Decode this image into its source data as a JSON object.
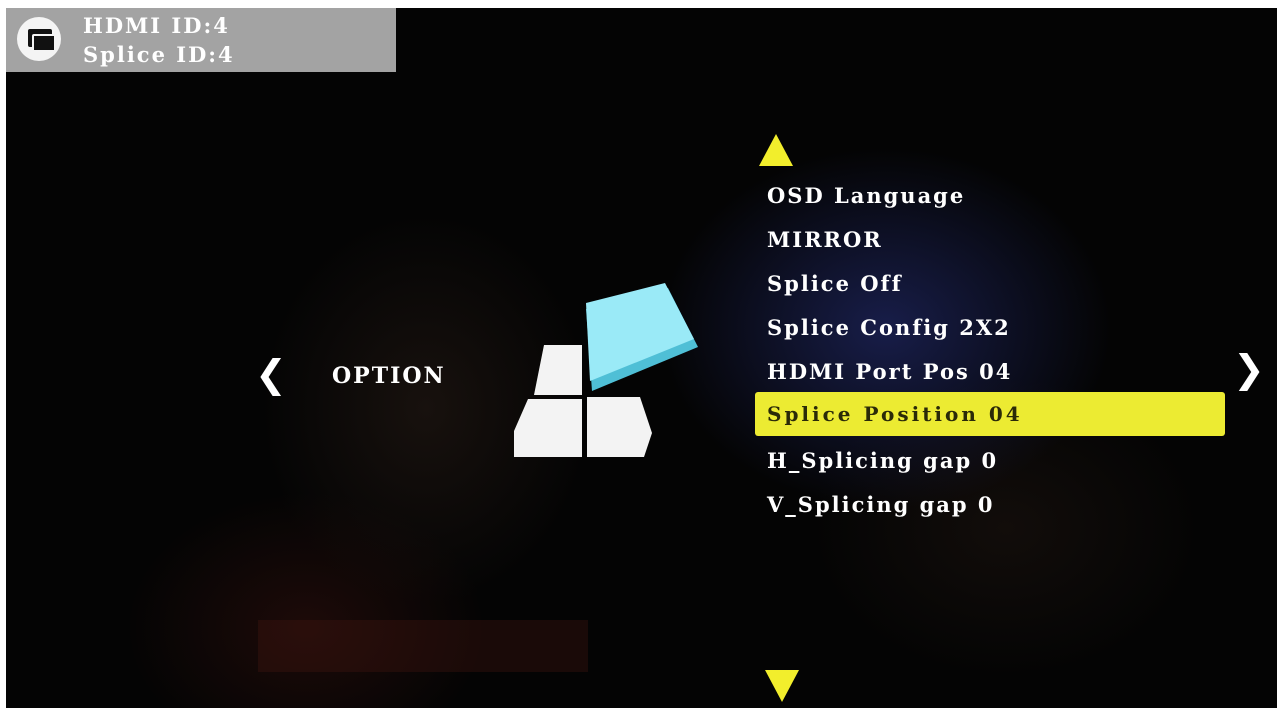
{
  "status_panel": {
    "icon": "window-icon",
    "hdmi_id": "HDMI ID:4",
    "splice_id": "Splice ID:4"
  },
  "navigation": {
    "prev_glyph": "❮",
    "next_glyph": "❯",
    "category_label": "OPTION",
    "category_icon": "option-blocks-icon"
  },
  "menu": {
    "scroll_up_icon": "triangle-up-icon",
    "scroll_down_icon": "triangle-down-icon",
    "items": [
      {
        "label": "OSD Language"
      },
      {
        "label": "MIRROR"
      },
      {
        "label": "Splice Off"
      },
      {
        "label": "Splice Config 2X2"
      },
      {
        "label": "HDMI Port Pos 04"
      },
      {
        "label": "Splice Position 04",
        "selected": true
      },
      {
        "label": "H_Splicing gap 0"
      },
      {
        "label": "V_Splicing gap 0"
      }
    ]
  },
  "colors": {
    "highlight": "#eceb32",
    "arrow": "#f2ee2c",
    "panel": "#a3a3a3",
    "accent_block": "#8be8f6"
  }
}
